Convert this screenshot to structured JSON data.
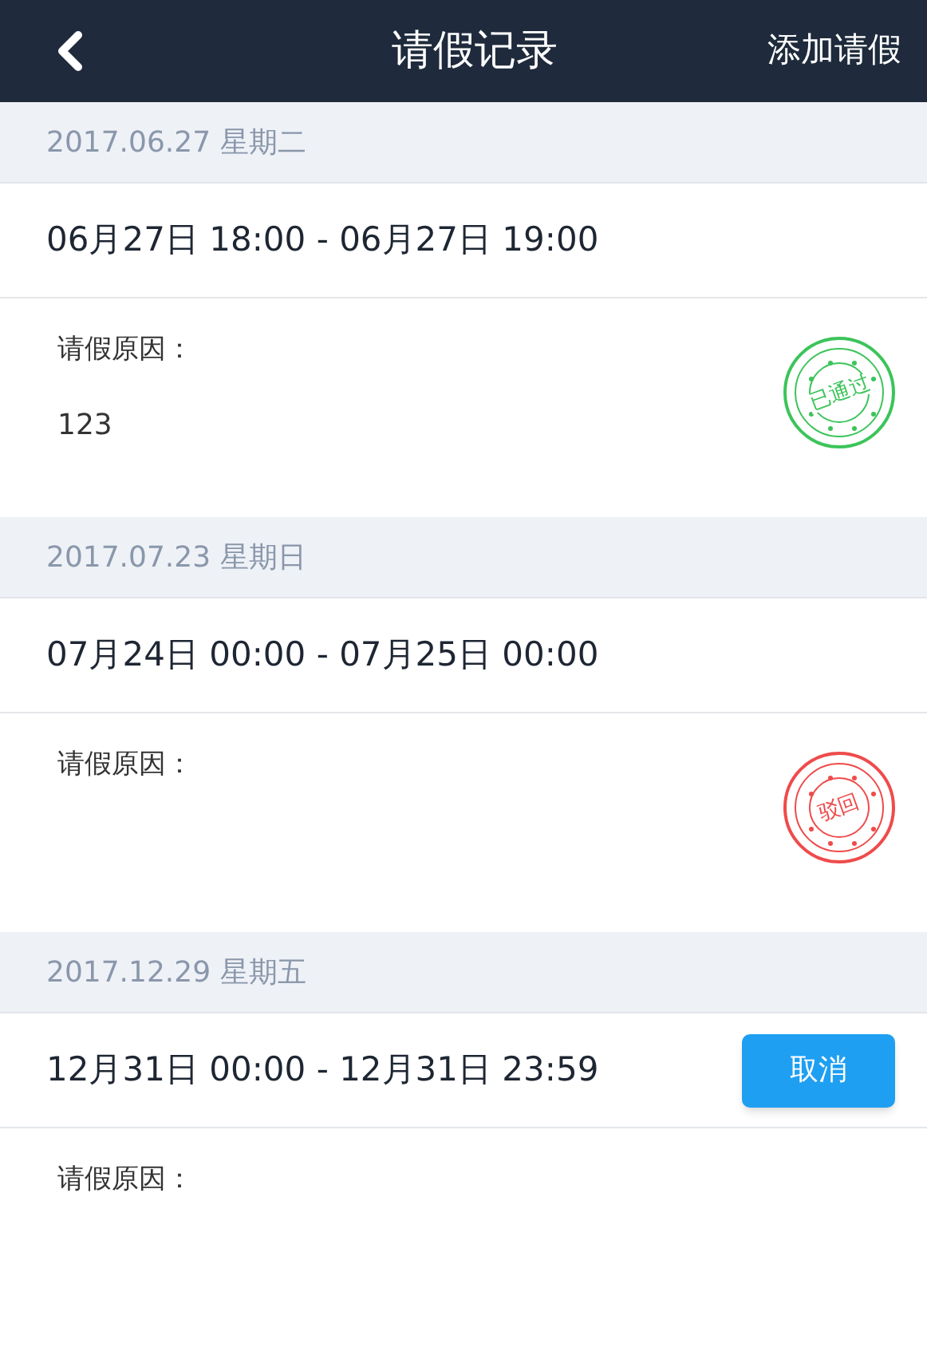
{
  "header": {
    "title": "请假记录",
    "action": "添加请假"
  },
  "records": [
    {
      "date": "2017.06.27 星期二",
      "time": "06月27日 18:00 - 06月27日 19:00",
      "reason_label": "请假原因：",
      "reason": "123",
      "status": {
        "kind": "approved",
        "text": "已通过"
      }
    },
    {
      "date": "2017.07.23 星期日",
      "time": "07月24日 00:00 - 07月25日 00:00",
      "reason_label": "请假原因：",
      "status": {
        "kind": "rejected",
        "text": "驳回"
      }
    },
    {
      "date": "2017.12.29 星期五",
      "time": "12月31日 00:00 - 12月31日 23:59",
      "reason_label": "请假原因：",
      "status": {
        "kind": "pending",
        "text": "取消"
      }
    }
  ]
}
